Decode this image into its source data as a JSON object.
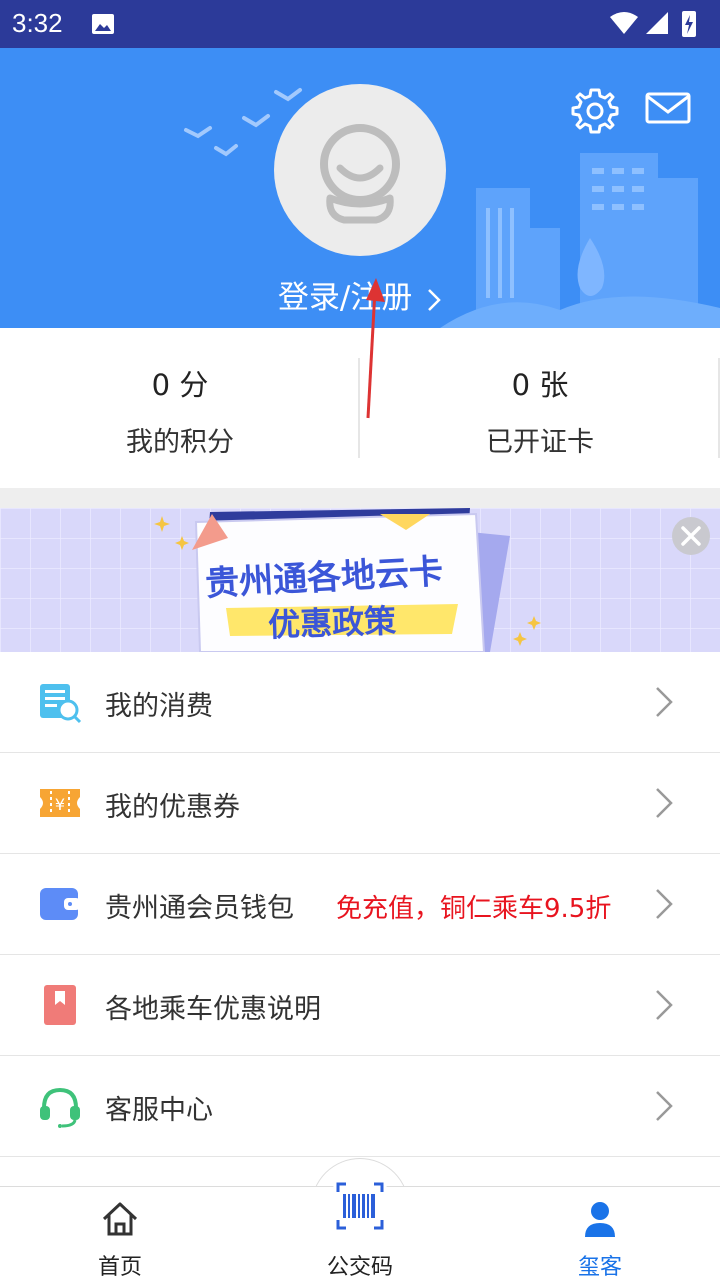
{
  "status_bar": {
    "time": "3:32"
  },
  "header": {
    "login_text": "登录/注册"
  },
  "stats": [
    {
      "value": "0 分",
      "label": "我的积分"
    },
    {
      "value": "0 张",
      "label": "已开证卡"
    }
  ],
  "banner": {
    "line1": "贵州通各地云卡",
    "line2": "优惠政策"
  },
  "menu": [
    {
      "label": "我的消费",
      "icon": "receipt-icon"
    },
    {
      "label": "我的优惠券",
      "icon": "coupon-icon"
    },
    {
      "label": "贵州通会员钱包",
      "promo": "免充值，铜仁乘车9.5折",
      "icon": "wallet-icon"
    },
    {
      "label": "各地乘车优惠说明",
      "icon": "bookmark-icon"
    },
    {
      "label": "客服中心",
      "icon": "headset-icon"
    }
  ],
  "nav": [
    {
      "label": "首页",
      "icon": "home-icon"
    },
    {
      "label": "公交码",
      "icon": "barcode-scan-icon"
    },
    {
      "label": "玺客",
      "icon": "user-icon",
      "active": true
    }
  ],
  "colors": {
    "header_bg": "#3d8ef5",
    "status_bg": "#2c3a99",
    "accent": "#1a73e8",
    "promo": "#e8141f"
  }
}
